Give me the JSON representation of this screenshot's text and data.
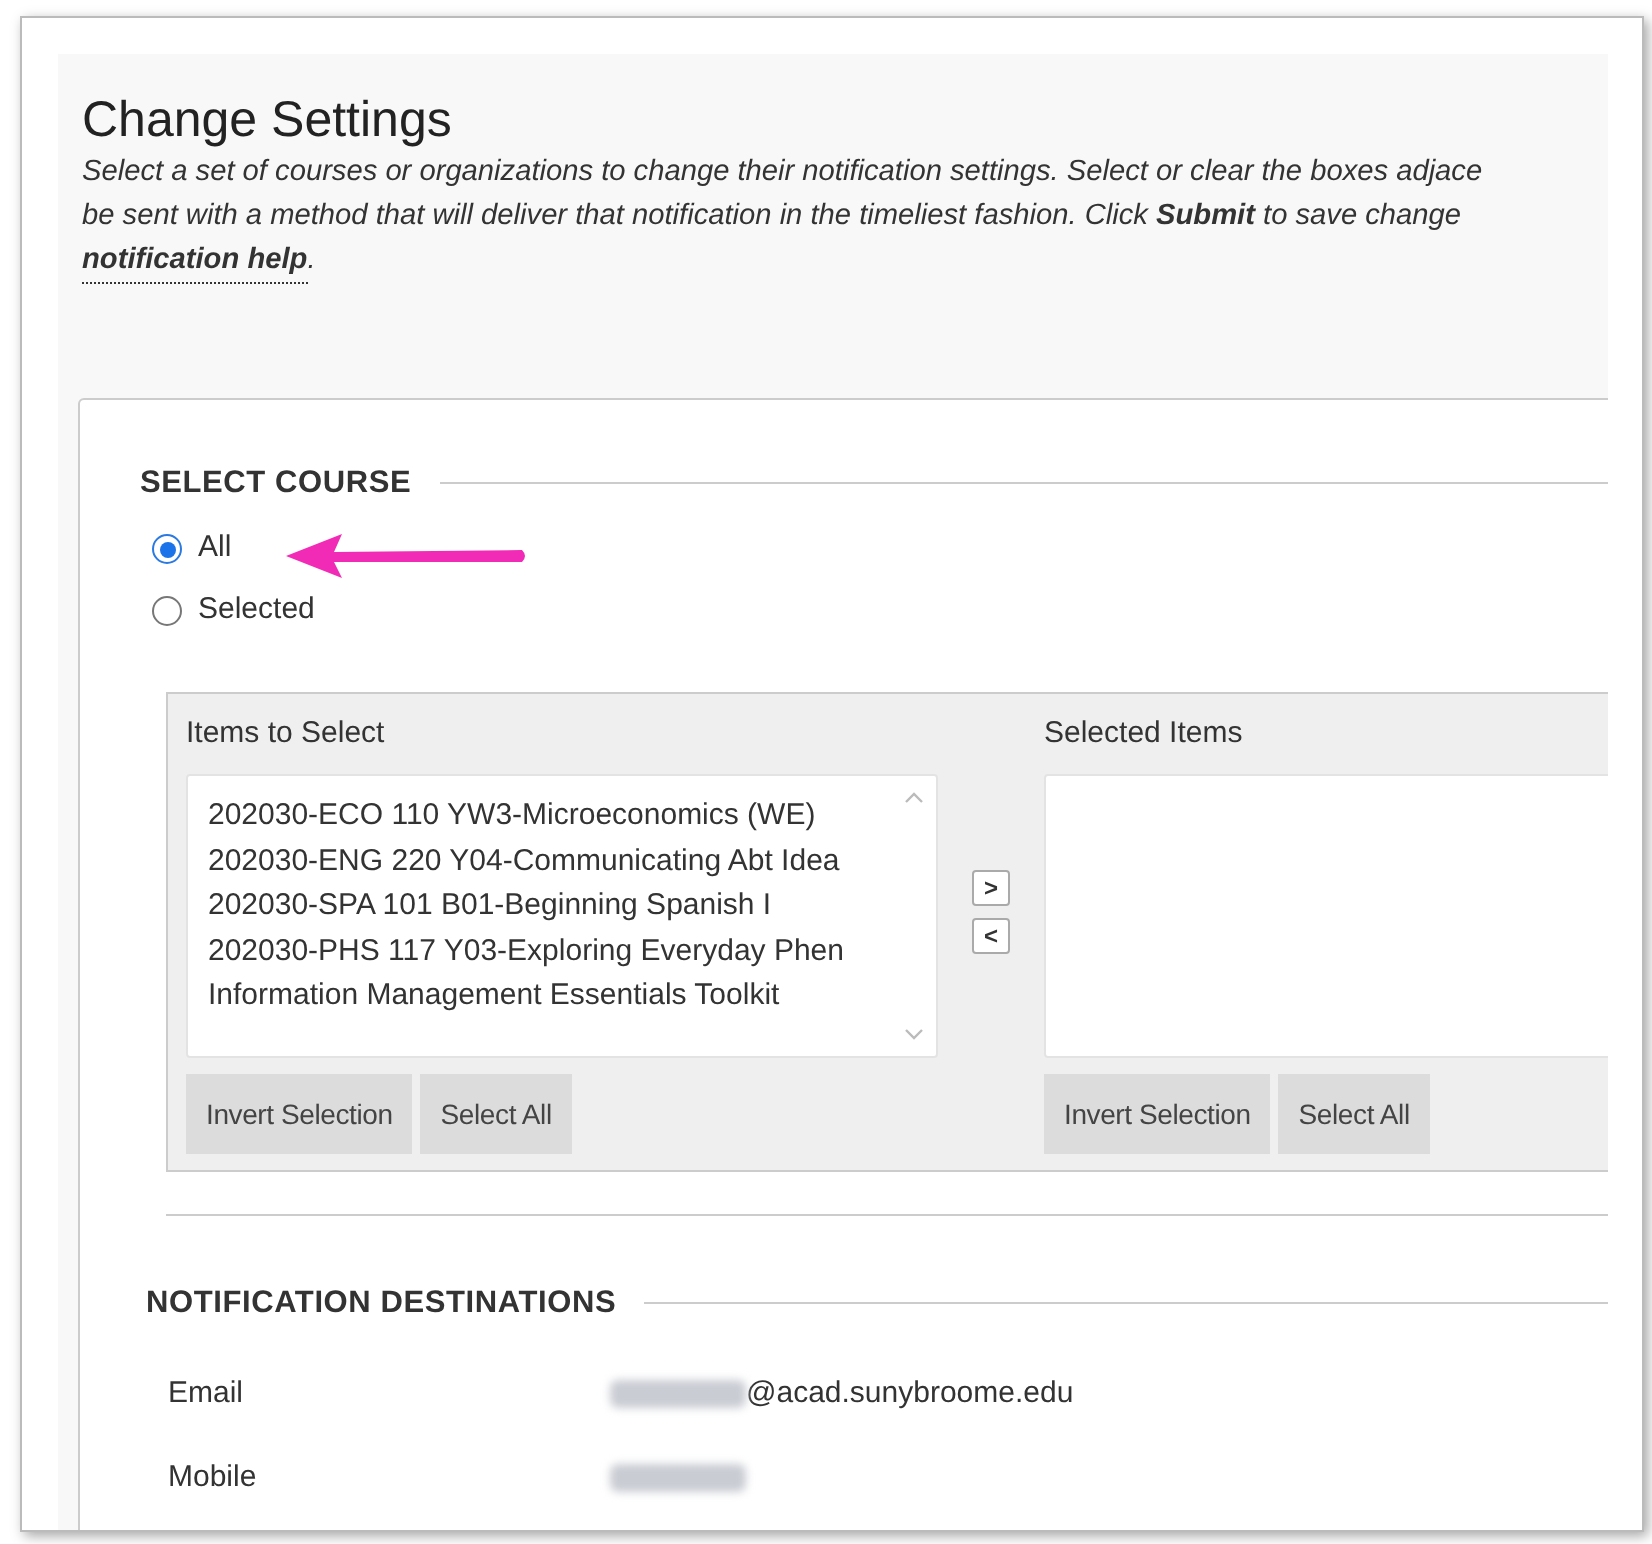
{
  "title": "Change Settings",
  "description_lines": [
    "Select a set of courses or organizations to change their notification settings. Select or clear the boxes adjace",
    "be sent with a method that will deliver that notification in the timeliest fashion. Click **Submit** to save change"
  ],
  "help_link": "notification help",
  "help_suffix": ".",
  "select_course": {
    "heading": "SELECT COURSE",
    "options": [
      {
        "label": "All",
        "selected": true
      },
      {
        "label": "Selected",
        "selected": false
      }
    ],
    "items_label": "Items to Select",
    "items": [
      "202030-ECO 110 YW3-Microeconomics (WE)",
      "202030-ENG 220 Y04-Communicating Abt Idea",
      "202030-SPA 101 B01-Beginning Spanish I",
      "202030-PHS 117 Y03-Exploring Everyday Phen",
      "Information Management Essentials Toolkit"
    ],
    "move_buttons": [
      ">",
      "<"
    ],
    "selected_label": "Selected Items",
    "left_buttons": [
      "Invert Selection",
      "Select All"
    ],
    "right_buttons": [
      "Invert Selection",
      "Select All"
    ]
  },
  "destinations": {
    "heading": "NOTIFICATION DESTINATIONS",
    "rows": [
      {
        "label": "Email",
        "value": "@acad.sunybroome.edu"
      },
      {
        "label": "Mobile",
        "value": ""
      }
    ]
  }
}
